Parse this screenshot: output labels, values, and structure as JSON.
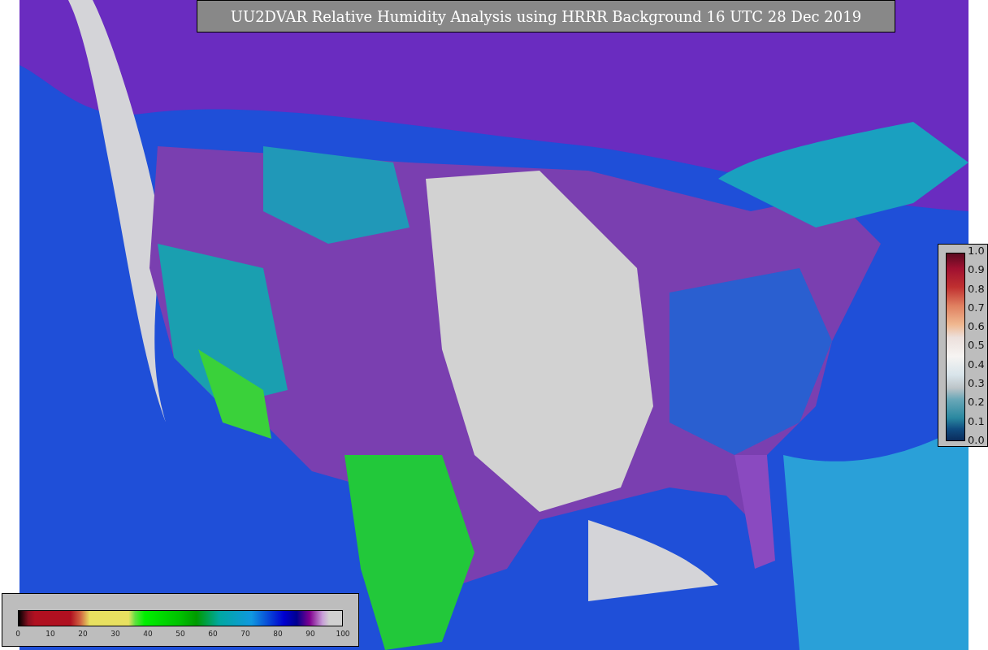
{
  "title": "UU2DVAR Relative Humidity Analysis using HRRR Background 16 UTC 28 Dec 2019",
  "humidity_colorbar": {
    "ticks": [
      "0",
      "10",
      "20",
      "30",
      "40",
      "50",
      "60",
      "70",
      "80",
      "90",
      "100"
    ]
  },
  "observation_colorbar": {
    "ticks": [
      "1.0",
      "0.9",
      "0.8",
      "0.7",
      "0.6",
      "0.5",
      "0.4",
      "0.3",
      "0.2",
      "0.1",
      "0.0"
    ]
  }
}
